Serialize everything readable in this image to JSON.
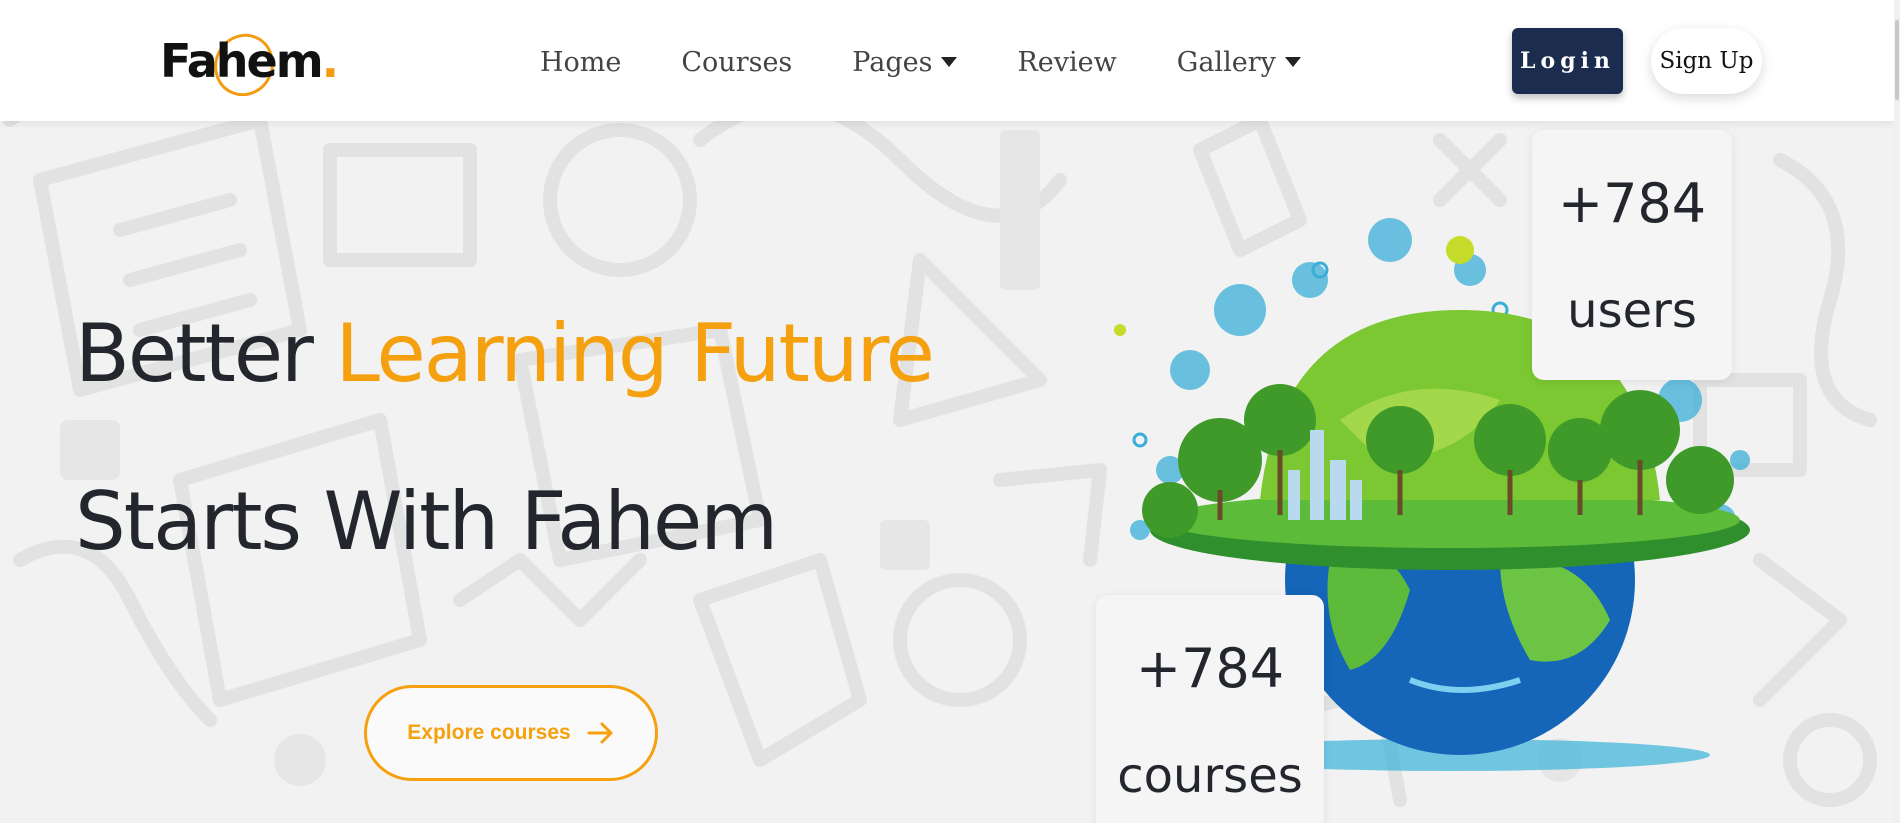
{
  "brand": {
    "logo_text": "Fahem",
    "logo_dot": ".",
    "accent_color": "#f5a00f",
    "dark_color": "#1b2c4f"
  },
  "nav": {
    "items": [
      {
        "label": "Home",
        "has_dropdown": false
      },
      {
        "label": "Courses",
        "has_dropdown": false
      },
      {
        "label": "Pages",
        "has_dropdown": true
      },
      {
        "label": "Review",
        "has_dropdown": false
      },
      {
        "label": "Gallery",
        "has_dropdown": true
      }
    ],
    "login_label": "Login",
    "signup_label": "Sign Up"
  },
  "hero": {
    "line1_plain": "Better ",
    "line1_accent": "Learning Future",
    "line2": "Starts With Fahem",
    "cta_label": "Explore courses",
    "cta_icon": "arrow-right-icon"
  },
  "stats": {
    "users": {
      "value": "+784",
      "label": "users"
    },
    "courses": {
      "value": "+784",
      "label": "courses"
    }
  }
}
